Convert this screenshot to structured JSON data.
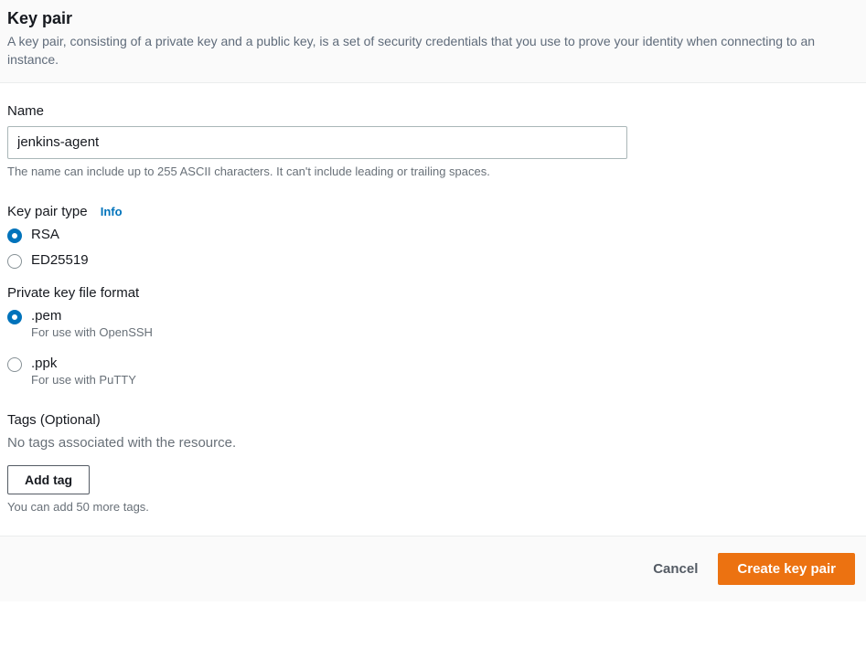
{
  "header": {
    "title": "Key pair",
    "description": "A key pair, consisting of a private key and a public key, is a set of security credentials that you use to prove your identity when connecting to an instance."
  },
  "name_section": {
    "label": "Name",
    "value": "jenkins-agent",
    "hint": "The name can include up to 255 ASCII characters. It can't include leading or trailing spaces."
  },
  "type_section": {
    "label": "Key pair type",
    "info": "Info",
    "options": [
      {
        "label": "RSA",
        "selected": true
      },
      {
        "label": "ED25519",
        "selected": false
      }
    ]
  },
  "format_section": {
    "label": "Private key file format",
    "options": [
      {
        "label": ".pem",
        "sub": "For use with OpenSSH",
        "selected": true
      },
      {
        "label": ".ppk",
        "sub": "For use with PuTTY",
        "selected": false
      }
    ]
  },
  "tags_section": {
    "label": "Tags (Optional)",
    "empty_text": "No tags associated with the resource.",
    "add_button": "Add tag",
    "limit_hint": "You can add 50 more tags."
  },
  "footer": {
    "cancel": "Cancel",
    "submit": "Create key pair"
  }
}
